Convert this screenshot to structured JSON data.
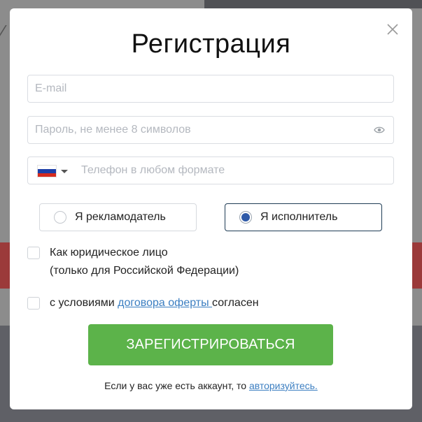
{
  "modal": {
    "title": "Регистрация",
    "email_placeholder": "E-mail",
    "password_placeholder": "Пароль, не менее 8 символов",
    "phone_placeholder": "Телефон в любом формате",
    "country_flag": "ru-flag-icon",
    "roles": [
      {
        "label": "Я рекламодатель",
        "selected": false
      },
      {
        "label": "Я исполнитель",
        "selected": true
      }
    ],
    "legal_entity_line1": "Как юридическое лицо",
    "legal_entity_line2": "(только для Российской Федерации)",
    "terms_prefix": "с условиями ",
    "terms_link": "договора оферты ",
    "terms_suffix": "согласен",
    "submit_label": "ЗАРЕГИСТРИРОВАТЬСЯ",
    "footer_prefix": "Если у вас уже есть аккаунт, то ",
    "footer_link": "авторизуйтесь."
  },
  "colors": {
    "submit_bg": "#5cb34a",
    "link": "#3b7ec1",
    "selected_radio": "#2f5aa8",
    "selected_border": "#1f3c55"
  }
}
